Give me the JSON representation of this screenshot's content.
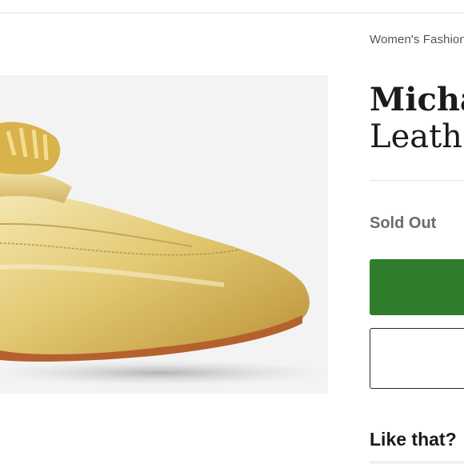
{
  "breadcrumb": {
    "text": "Women's Fashion"
  },
  "product": {
    "title_line1": "Micha",
    "title_line2": "Leathe",
    "status": "Sold Out",
    "image_icon": "gold-loafer-shoe"
  },
  "actions": {
    "primary_label": "",
    "secondary_label": ""
  },
  "recommendations": {
    "heading": "Like that?"
  },
  "colors": {
    "primary_button": "#2f7d2c",
    "status_text": "#6b6b6b",
    "image_background": "#f3f3f3"
  }
}
